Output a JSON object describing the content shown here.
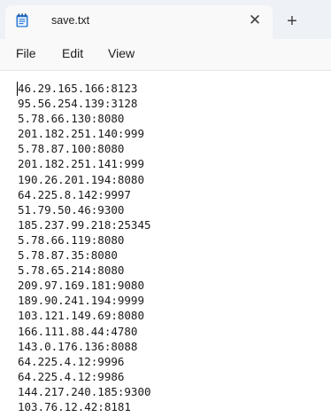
{
  "tab": {
    "title": "save.txt",
    "close_glyph": "✕",
    "icon": "notepad-icon"
  },
  "new_tab_glyph": "+",
  "menu": {
    "file": "File",
    "edit": "Edit",
    "view": "View"
  },
  "document": {
    "lines": [
      "46.29.165.166:8123",
      "95.56.254.139:3128",
      "5.78.66.130:8080",
      "201.182.251.140:999",
      "5.78.87.100:8080",
      "201.182.251.141:999",
      "190.26.201.194:8080",
      "64.225.8.142:9997",
      "51.79.50.46:9300",
      "185.237.99.218:25345",
      "5.78.66.119:8080",
      "5.78.87.35:8080",
      "5.78.65.214:8080",
      "209.97.169.181:9080",
      "189.90.241.194:9999",
      "103.121.149.69:8080",
      "166.111.88.44:4780",
      "143.0.176.136:8088",
      "64.225.4.12:9996",
      "64.225.4.12:9986",
      "144.217.240.185:9300",
      "103.76.12.42:8181"
    ]
  },
  "colors": {
    "tab_strip": "#eef1f6",
    "active_tab": "#f9f9f9",
    "menu_bar": "#f9f9f9",
    "editor_bg": "#ffffff",
    "icon_blue": "#2b78d6",
    "icon_accent": "#7fc3f0"
  }
}
